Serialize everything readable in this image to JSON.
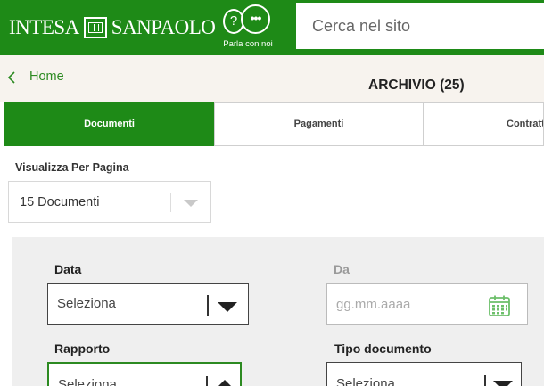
{
  "header": {
    "logo_left": "INTESA",
    "logo_right": "SANPAOLO",
    "chat_q": "?",
    "chat_dots": "•••",
    "chat_label": "Parla con noi",
    "search_placeholder": "Cerca nel sito"
  },
  "breadcrumb": {
    "home": "Home"
  },
  "page": {
    "title": "ARCHIVIO (25)"
  },
  "tabs": [
    {
      "label": "Documenti",
      "active": true
    },
    {
      "label": "Pagamenti",
      "active": false
    },
    {
      "label": "Contratti",
      "active": false
    }
  ],
  "perpage": {
    "label": "Visualizza Per Pagina",
    "value": "15 Documenti"
  },
  "filters": {
    "data_label": "Data",
    "data_value": "Seleziona",
    "da_label": "Da",
    "da_placeholder": "gg.mm.aaaa",
    "rapporto_label": "Rapporto",
    "rapporto_value": "Seleziona",
    "tipo_label": "Tipo documento",
    "tipo_value": "Seleziona"
  },
  "colors": {
    "brand_green": "#1e8a17",
    "link_green": "#2c8a21",
    "calendar_green": "#6cbf6a"
  },
  "icons": {
    "back": "chevron-left-icon",
    "calendar": "calendar-icon",
    "chat": "chat-icon",
    "dropdown": "caret-down-icon"
  }
}
